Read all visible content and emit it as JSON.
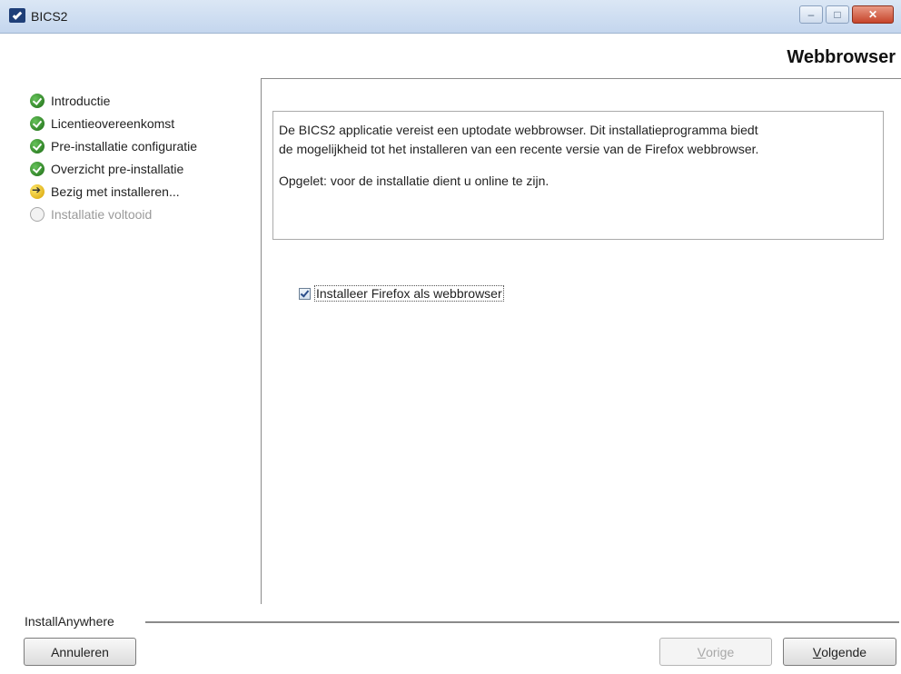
{
  "window": {
    "title": "BICS2",
    "minimize_glyph": "–",
    "maximize_glyph": "□",
    "close_glyph": "✕"
  },
  "page_heading": "Webbrowser",
  "steps": [
    {
      "label": "Introductie",
      "status": "done",
      "icon": "check-circle-icon"
    },
    {
      "label": "Licentieovereenkomst",
      "status": "done",
      "icon": "check-circle-icon"
    },
    {
      "label": "Pre-installatie configuratie",
      "status": "done",
      "icon": "check-circle-icon"
    },
    {
      "label": "Overzicht pre-installatie",
      "status": "done",
      "icon": "check-circle-icon"
    },
    {
      "label": "Bezig met installeren...",
      "status": "current",
      "icon": "arrow-circle-icon"
    },
    {
      "label": "Installatie voltooid",
      "status": "pending",
      "icon": "empty-circle-icon"
    }
  ],
  "info": {
    "line1": "De BICS2 applicatie vereist een uptodate webbrowser. Dit installatieprogramma biedt",
    "line2": "de mogelijkheid tot het installeren van een recente versie van de Firefox webbrowser.",
    "note": "Opgelet: voor de installatie dient u online te zijn."
  },
  "option": {
    "label": "Installeer Firefox als webbrowser",
    "checked": true
  },
  "footer": {
    "vendor": "InstallAnywhere",
    "cancel": "Annuleren",
    "prev_mnemonic": "V",
    "prev_rest": "orige",
    "next_mnemonic": "V",
    "next_rest": "olgende"
  }
}
